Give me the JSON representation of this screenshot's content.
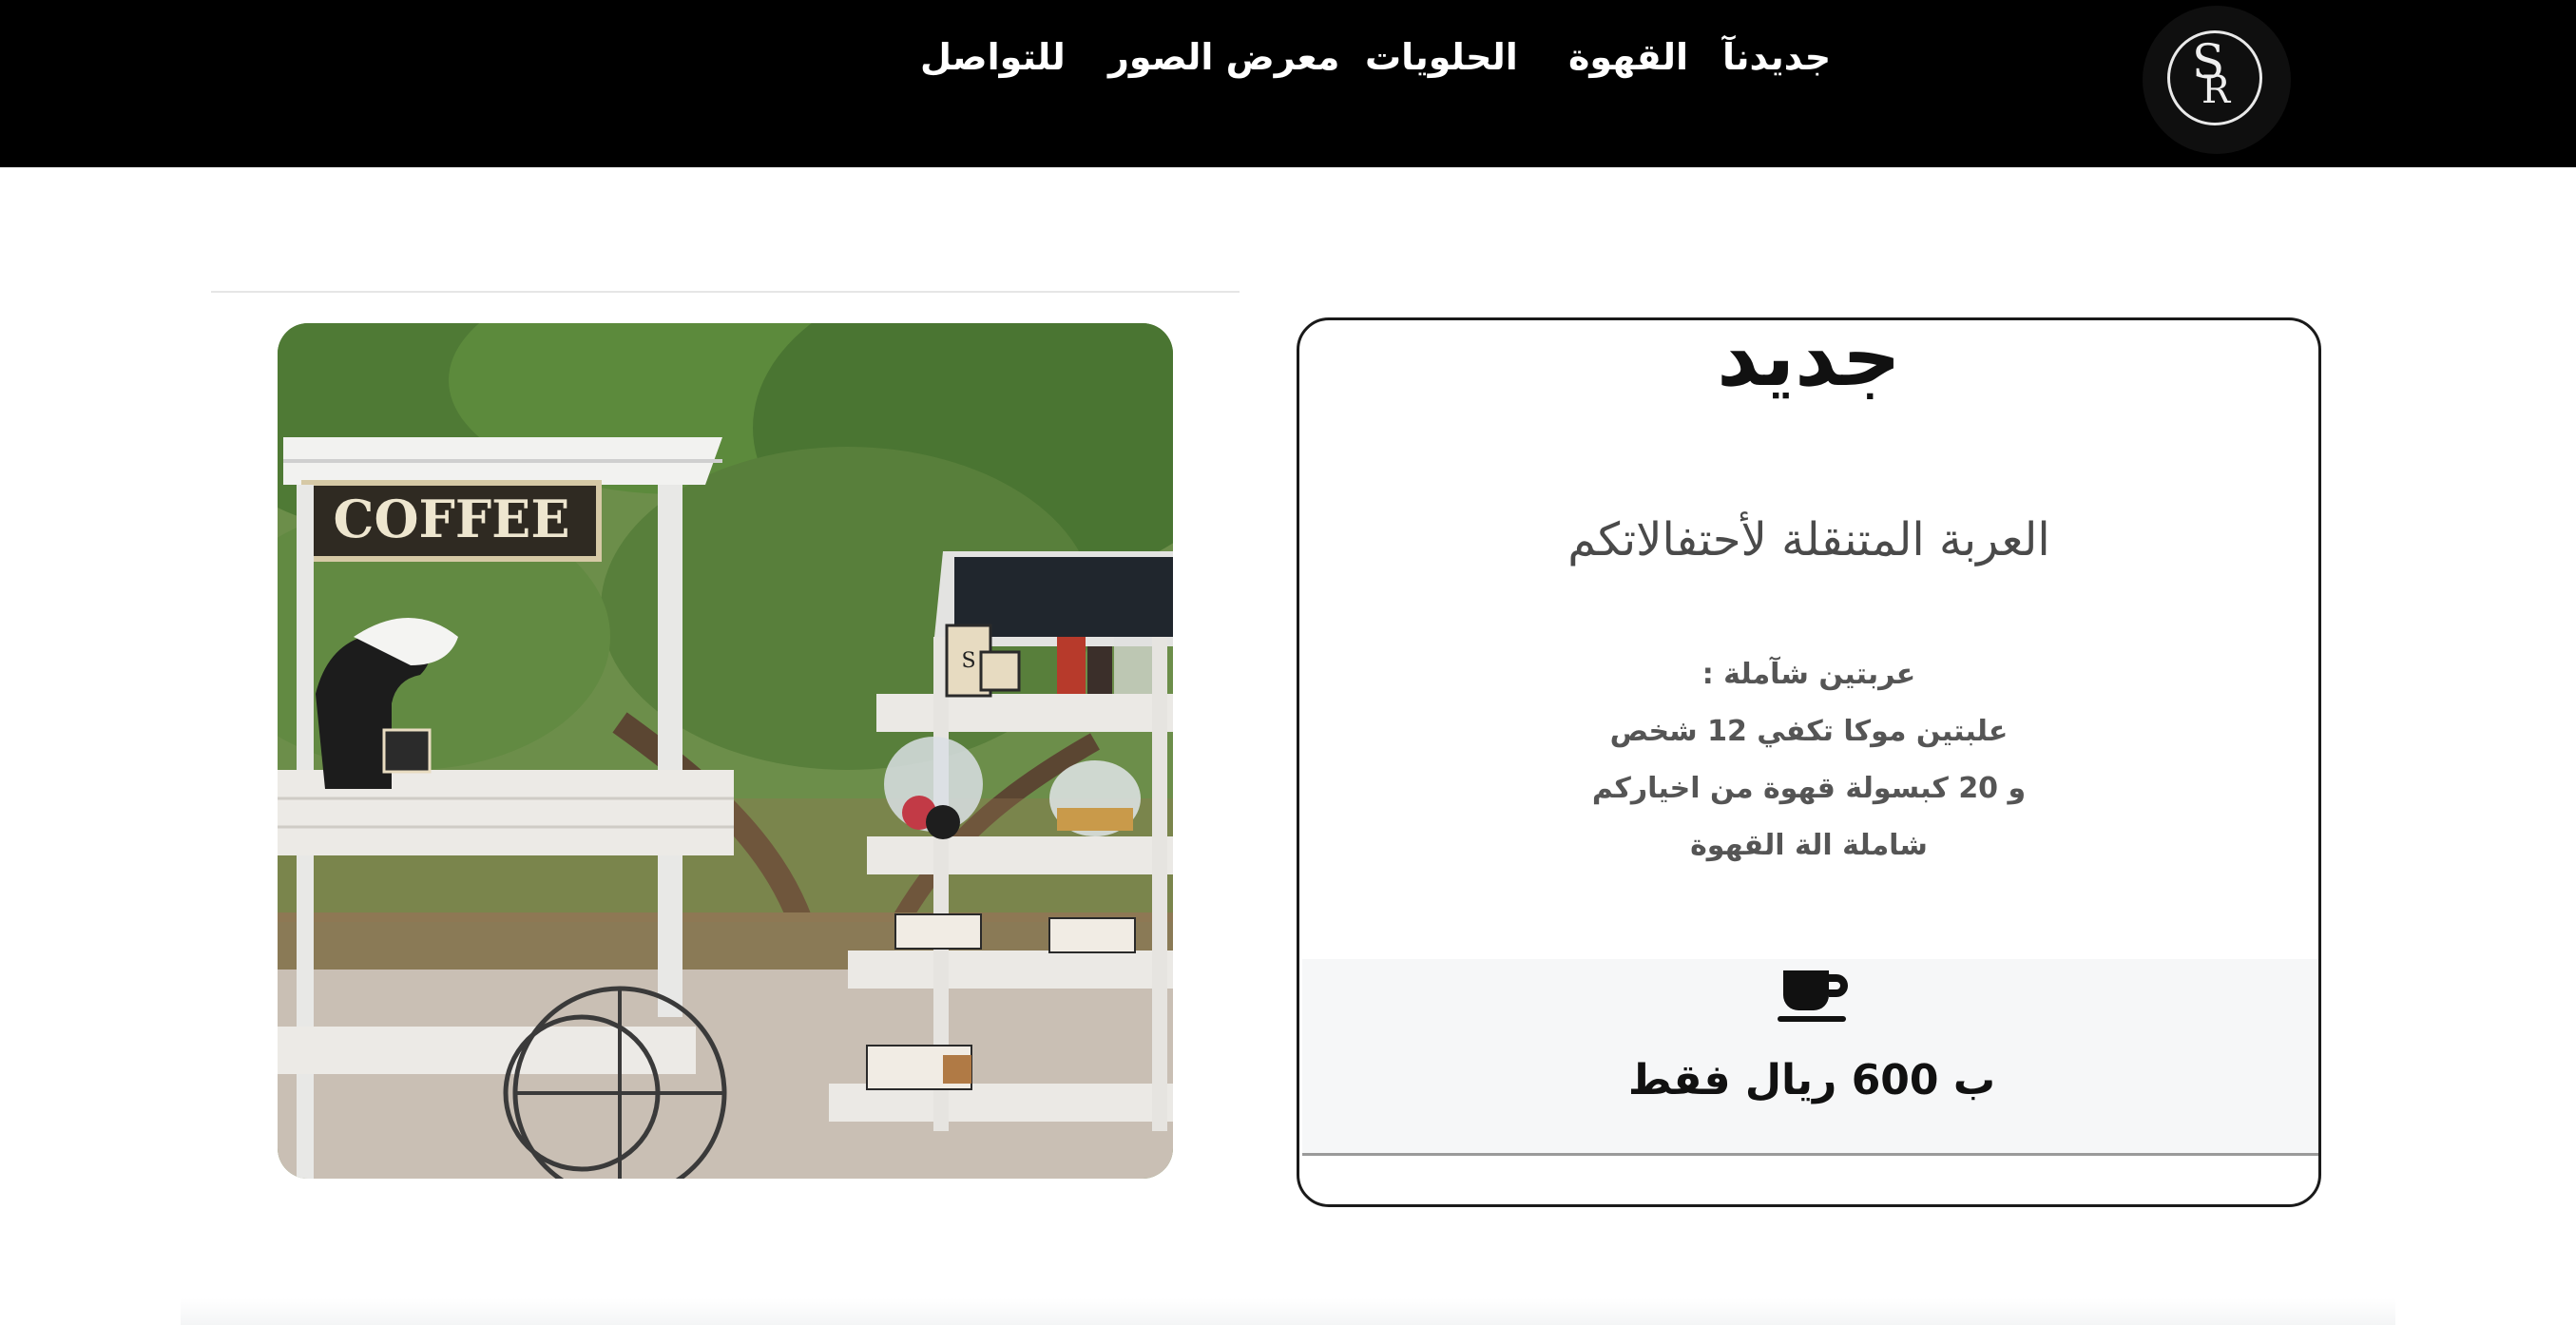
{
  "nav": {
    "items": [
      "جديدنآ",
      "القهوة",
      "الحلويات",
      "معرض الصور",
      "للتواصل"
    ],
    "logo_text": "SR"
  },
  "card": {
    "title": "جديد",
    "subtitle": "العربة المتنقلة لأحتفالاتكم",
    "details": [
      "عربتين شآملة :",
      "علبتين موكا تكفي 12 شخص",
      "و 20 كبسولة قهوة من اخياركم",
      "شاملة الة القهوة"
    ],
    "icon": "coffee-cup-icon",
    "price": "ب 600 ريال فقط"
  },
  "photo": {
    "sign_text": "COFFEE",
    "cup_logo": "S"
  },
  "colors": {
    "navbar": "#000000",
    "nav_text": "#ffffff",
    "card_footer": "#f6f7f8"
  }
}
